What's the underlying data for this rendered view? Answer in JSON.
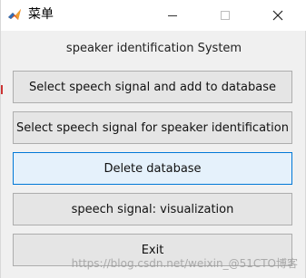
{
  "window": {
    "title": "菜单",
    "controls": {
      "minimize_icon": "minimize-icon",
      "maximize_icon": "maximize-icon",
      "close_icon": "close-icon"
    }
  },
  "main": {
    "system_label": "speaker  identification System",
    "buttons": [
      {
        "label": "Select speech signal and add to database"
      },
      {
        "label": "Select speech signal for speaker identification"
      },
      {
        "label": "Delete database"
      },
      {
        "label": "speech signal: visualization"
      },
      {
        "label": "Exit"
      }
    ]
  },
  "watermark": "https://blog.csdn.net/weixin_@51CTO博客",
  "colors": {
    "focus_border": "#0078d7",
    "focus_fill": "#e5f1fb",
    "button_fill": "#e5e5e5"
  }
}
